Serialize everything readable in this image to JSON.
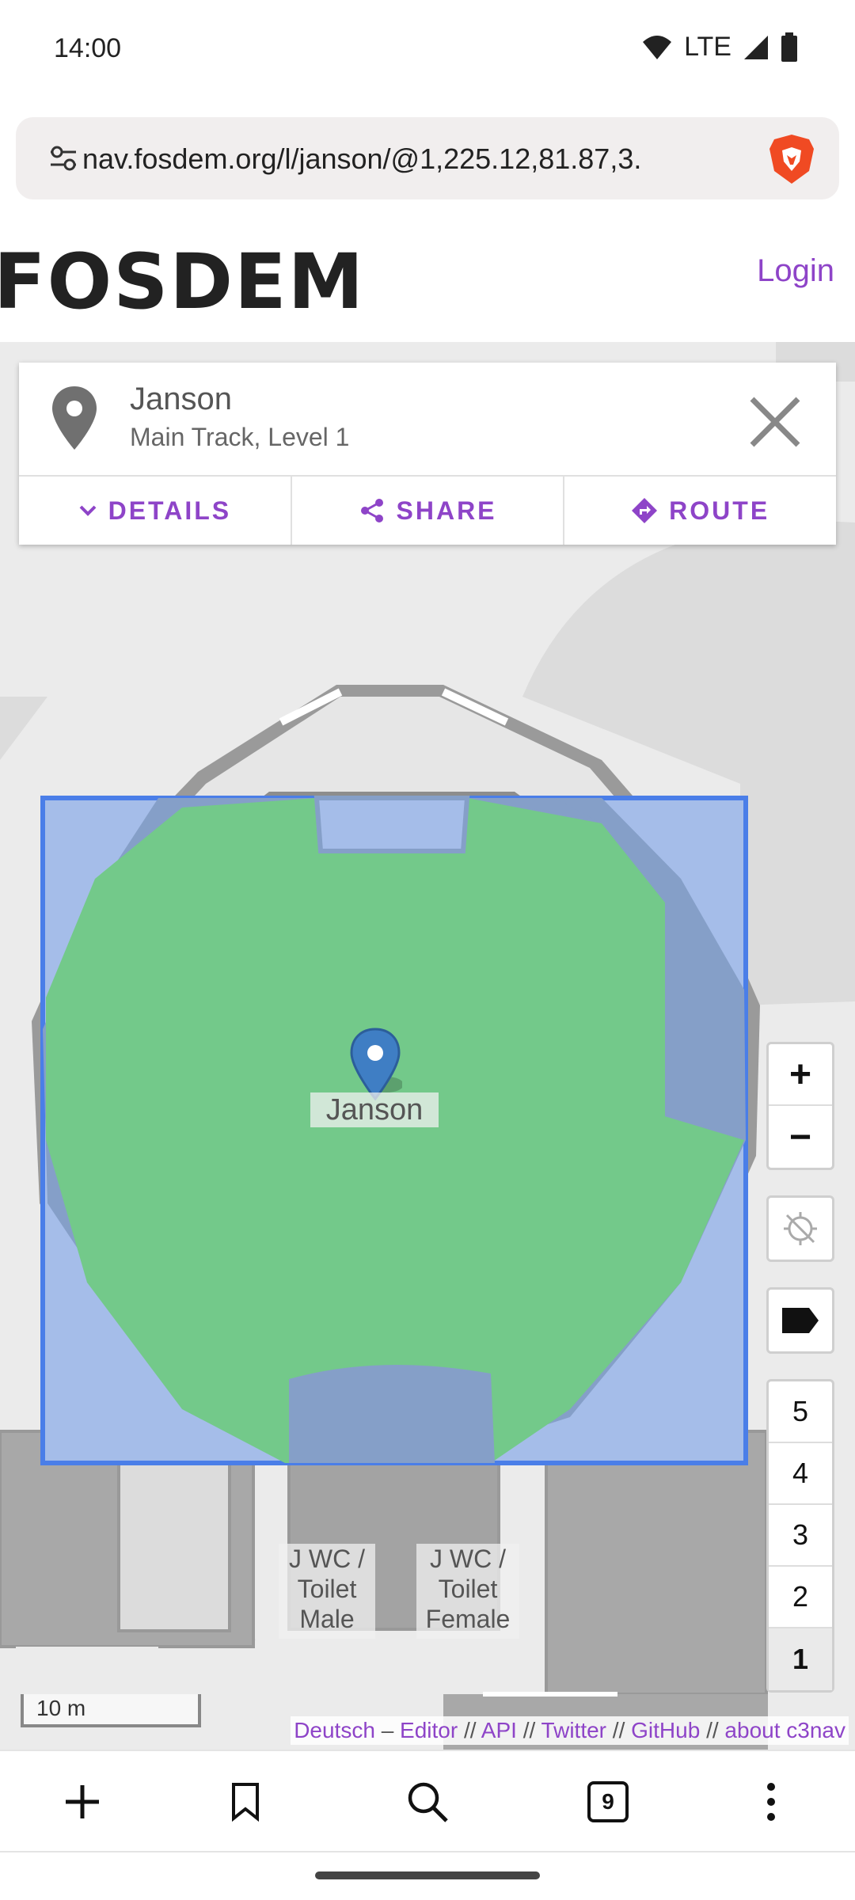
{
  "status_bar": {
    "time": "14:00",
    "network": "LTE"
  },
  "browser": {
    "url": "nav.fosdem.org/l/janson/@1,225.12,81.87,3.",
    "tab_count": "9"
  },
  "site": {
    "logo": "FOSDEM",
    "login_label": "Login"
  },
  "location_card": {
    "title": "Janson",
    "subtitle": "Main Track, Level 1",
    "actions": [
      {
        "label": "DETAILS",
        "icon": "chevron-down-icon"
      },
      {
        "label": "SHARE",
        "icon": "share-icon"
      },
      {
        "label": "ROUTE",
        "icon": "route-icon"
      }
    ]
  },
  "map": {
    "marker_label": "Janson",
    "room_labels": [
      "J WC / Toilet Male",
      "J WC / Toilet Female"
    ],
    "zoom_in": "+",
    "zoom_out": "−",
    "levels": [
      "5",
      "4",
      "3",
      "2",
      "1"
    ],
    "active_level": "1",
    "scale": "10 m",
    "colors": {
      "room_fill": "#73c98a",
      "selection": "#4a7ee8",
      "building": "#a0a0a0",
      "accent": "#8e44c8"
    }
  },
  "attribution": {
    "deutsch": "Deutsch",
    "dash": "–",
    "editor": "Editor",
    "sep": "//",
    "api": "API",
    "twitter": "Twitter",
    "github": "GitHub",
    "about": "about c3nav"
  }
}
